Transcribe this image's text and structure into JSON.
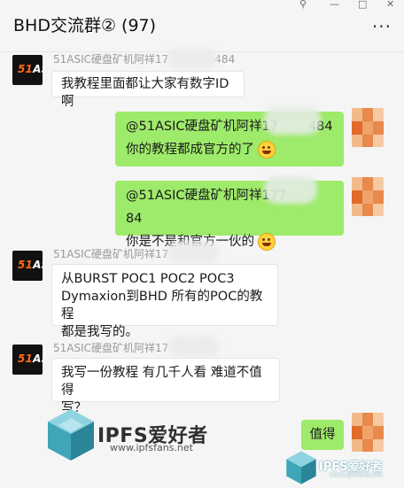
{
  "window": {
    "title": "BHD交流群② (97)",
    "controls": [
      "⚲",
      "—",
      "□",
      "✕"
    ],
    "more_icon": "···"
  },
  "messages": [
    {
      "side": "left",
      "sender": "51ASIC硬盘矿机阿祥17",
      "sender_tail": "484",
      "avatar_text": "51ASIC",
      "lines": [
        "我教程里面都让大家有数字ID啊"
      ]
    },
    {
      "side": "right",
      "mention": "@51ASIC硬盘矿机阿祥17",
      "mention_tail": "484",
      "text": "你的教程都成官方的了",
      "emoji": "laugh-cry-emoji"
    },
    {
      "side": "right",
      "mention": "@51ASIC硬盘矿机阿祥177",
      "mention_tail": "84",
      "text": "你是不是和官方一伙的",
      "emoji": "grin-emoji"
    },
    {
      "side": "left",
      "sender": "51ASIC硬盘矿机阿祥17",
      "sender_tail": "",
      "avatar_text": "51ASIC",
      "lines": [
        "从BURST POC1 POC2 POC3",
        "Dymaxion到BHD  所有的POC的教程",
        "都是我写的。"
      ]
    },
    {
      "side": "left",
      "sender": "51ASIC硬盘矿机阿祥17",
      "sender_tail": "",
      "avatar_text": "51ASIC",
      "lines": [
        "我写一份教程 有几千人看  难道不值得",
        "写？"
      ]
    },
    {
      "side": "right",
      "text": "值得"
    }
  ],
  "watermark": {
    "brand": "IPFS爱好者",
    "url": "www.ipfsfans.net",
    "brand_small": "IPFS爱好者",
    "url_small": "www.ipfsfans.net"
  },
  "colors": {
    "bubble_green": "#9eea6a",
    "bubble_white": "#ffffff",
    "background": "#f5f5f5"
  }
}
